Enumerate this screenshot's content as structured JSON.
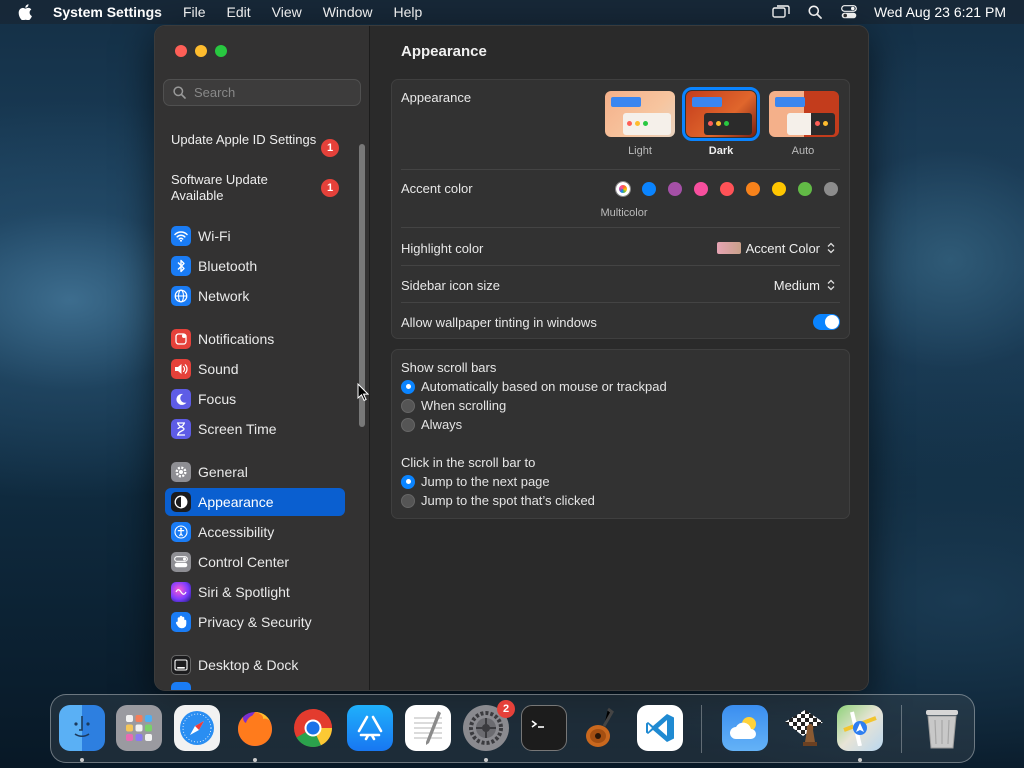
{
  "menubar": {
    "app_name": "System Settings",
    "menus": [
      "File",
      "Edit",
      "View",
      "Window",
      "Help"
    ],
    "clock": "Wed Aug 23  6:21 PM"
  },
  "sidebar": {
    "search_placeholder": "Search",
    "updates": [
      {
        "label": "Update Apple ID Settings",
        "badge": "1"
      },
      {
        "label": "Software Update Available",
        "badge": "1"
      }
    ],
    "items": [
      {
        "label": "Wi-Fi",
        "icon": "wifi-icon",
        "color": "#1a7cf5"
      },
      {
        "label": "Bluetooth",
        "icon": "bluetooth-icon",
        "color": "#1a7cf5"
      },
      {
        "label": "Network",
        "icon": "globe-icon",
        "color": "#1a7cf5"
      },
      {
        "label": "Notifications",
        "icon": "bell-icon",
        "color": "#e5413a"
      },
      {
        "label": "Sound",
        "icon": "speaker-icon",
        "color": "#e5413a"
      },
      {
        "label": "Focus",
        "icon": "moon-icon",
        "color": "#5e5ce6"
      },
      {
        "label": "Screen Time",
        "icon": "hourglass-icon",
        "color": "#5e5ce6"
      },
      {
        "label": "General",
        "icon": "gear-icon",
        "color": "#8e8e93"
      },
      {
        "label": "Appearance",
        "icon": "appearance-icon",
        "color": "#1c1c1e"
      },
      {
        "label": "Accessibility",
        "icon": "accessibility-icon",
        "color": "#1a7cf5"
      },
      {
        "label": "Control Center",
        "icon": "control-center-icon",
        "color": "#8e8e93"
      },
      {
        "label": "Siri & Spotlight",
        "icon": "siri-icon",
        "color": "#b14de0"
      },
      {
        "label": "Privacy & Security",
        "icon": "hand-icon",
        "color": "#1a7cf5"
      },
      {
        "label": "Desktop & Dock",
        "icon": "dock-icon",
        "color": "#1c1c1e"
      }
    ],
    "selected": "Appearance"
  },
  "main": {
    "title": "Appearance",
    "appearance": {
      "label": "Appearance",
      "options": [
        "Light",
        "Dark",
        "Auto"
      ],
      "selected": "Dark"
    },
    "accent": {
      "label": "Accent color",
      "multicolor_label": "Multicolor",
      "colors": [
        "multicolor",
        "#0a84ff",
        "#a550a7",
        "#f74f9e",
        "#ff5257",
        "#f7821b",
        "#ffc600",
        "#62ba46",
        "#8c8c8c"
      ]
    },
    "highlight": {
      "label": "Highlight color",
      "value": "Accent Color"
    },
    "sidebar_icon_size": {
      "label": "Sidebar icon size",
      "value": "Medium"
    },
    "wallpaper_tinting": {
      "label": "Allow wallpaper tinting in windows",
      "enabled": true
    },
    "scroll_bars": {
      "label": "Show scroll bars",
      "options": [
        "Automatically based on mouse or trackpad",
        "When scrolling",
        "Always"
      ],
      "selected": 0
    },
    "click_scroll": {
      "label": "Click in the scroll bar to",
      "options": [
        "Jump to the next page",
        "Jump to the spot that’s clicked"
      ],
      "selected": 0
    },
    "help": "?"
  },
  "dock": {
    "settings_badge": "2",
    "apps": [
      "Finder",
      "Launchpad",
      "Safari",
      "Firefox",
      "Chrome",
      "App Store",
      "TextEdit",
      "System Settings",
      "Terminal",
      "GarageBand",
      "Visual Studio Code",
      "Weather",
      "Chess",
      "Maps",
      "Trash"
    ]
  }
}
